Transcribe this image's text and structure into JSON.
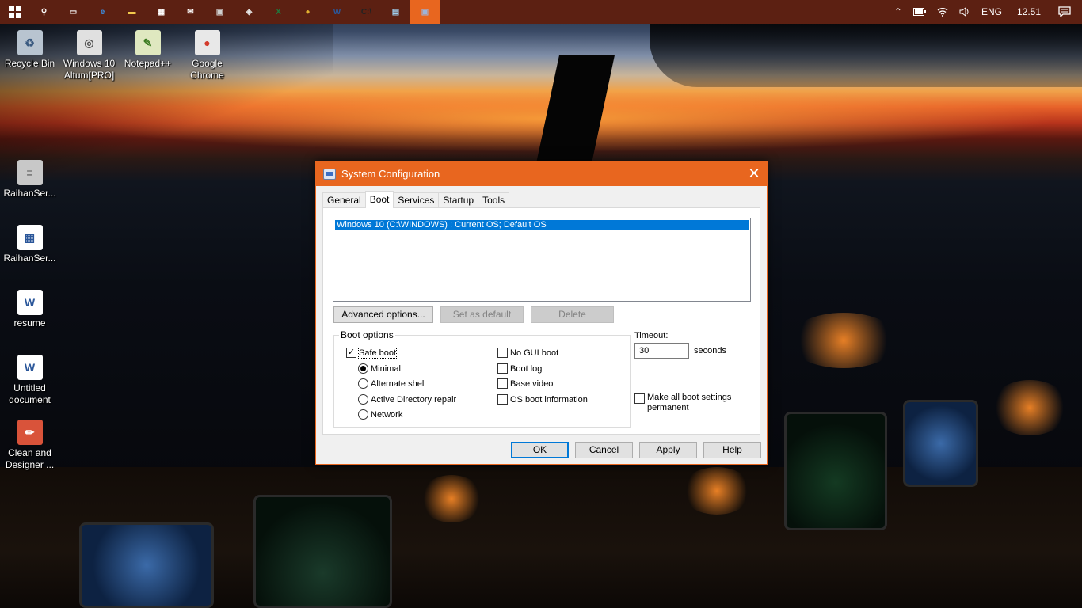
{
  "taskbar": {
    "start_icon": "windows-logo-icon",
    "apps": [
      {
        "name": "search-icon",
        "glyph": "⚲",
        "color": "#ffffff"
      },
      {
        "name": "task-view-icon",
        "glyph": "▭",
        "color": "#ffffff"
      },
      {
        "name": "edge-icon",
        "glyph": "e",
        "color": "#3b8de0"
      },
      {
        "name": "file-explorer-icon",
        "glyph": "▬",
        "color": "#f2c94c"
      },
      {
        "name": "store-icon",
        "glyph": "▦",
        "color": "#ffffff"
      },
      {
        "name": "mail-icon",
        "glyph": "✉",
        "color": "#ffffff"
      },
      {
        "name": "media-icon",
        "glyph": "▣",
        "color": "#cfcfcf"
      },
      {
        "name": "app-icon",
        "glyph": "◈",
        "color": "#e8e8e8"
      },
      {
        "name": "excel-icon",
        "glyph": "X",
        "color": "#1f7a3e"
      },
      {
        "name": "chrome-icon",
        "glyph": "●",
        "color": "#e0b030"
      },
      {
        "name": "word-icon",
        "glyph": "W",
        "color": "#2b579a"
      },
      {
        "name": "cmd-icon",
        "glyph": "C:\\",
        "color": "#222222"
      },
      {
        "name": "notepad-icon",
        "glyph": "▤",
        "color": "#9fd0f0"
      },
      {
        "name": "system-config-icon",
        "glyph": "▣",
        "color": "#9fb4d8"
      }
    ],
    "tray": {
      "chevron": "⌃",
      "lang": "ENG",
      "time": "12.51"
    }
  },
  "desktop": {
    "icons": [
      {
        "label": "Recycle Bin",
        "name": "recycle-bin-icon",
        "glyph": "♻",
        "bg": "#b8c4d0",
        "fg": "#3a5a80"
      },
      {
        "label": "Windows 10 Altum[PRO]",
        "name": "windows-iso-icon",
        "glyph": "◎",
        "bg": "#e0e0e0",
        "fg": "#555555"
      },
      {
        "label": "Notepad++",
        "name": "notepad-plus-icon",
        "glyph": "✎",
        "bg": "#dfe8c0",
        "fg": "#3a7a20"
      },
      {
        "label": "Google Chrome",
        "name": "google-chrome-icon",
        "glyph": "●",
        "bg": "#e8e8e8",
        "fg": "#d33b2c"
      },
      {
        "label": "RaihanSer...",
        "name": "server-icon",
        "glyph": "≡",
        "bg": "#c8c8c8",
        "fg": "#555555"
      },
      {
        "label": "RaihanSer...",
        "name": "calendar-file-icon",
        "glyph": "▦",
        "bg": "#ffffff",
        "fg": "#2b579a"
      },
      {
        "label": "resume",
        "name": "word-document-icon",
        "glyph": "W",
        "bg": "#ffffff",
        "fg": "#2b579a"
      },
      {
        "label": "Untitled document",
        "name": "word-document-icon-2",
        "glyph": "W",
        "bg": "#ffffff",
        "fg": "#2b579a"
      },
      {
        "label": "Clean and Designer ...",
        "name": "pencil-app-icon",
        "glyph": "✏",
        "bg": "#d9533a",
        "fg": "#ffffff"
      }
    ]
  },
  "dialog": {
    "title": "System Configuration",
    "close_glyph": "✕",
    "tabs": [
      "General",
      "Boot",
      "Services",
      "Startup",
      "Tools"
    ],
    "selected_tab": "Boot",
    "os_list": [
      "Windows 10 (C:\\WINDOWS) : Current OS; Default OS"
    ],
    "buttons": {
      "advanced": "Advanced options...",
      "set_default": "Set as default",
      "delete": "Delete"
    },
    "boot_options": {
      "legend": "Boot options",
      "safe_boot": {
        "label": "Safe boot",
        "checked": true
      },
      "radios": [
        {
          "label": "Minimal",
          "selected": true
        },
        {
          "label": "Alternate shell",
          "selected": false
        },
        {
          "label": "Active Directory repair",
          "selected": false
        },
        {
          "label": "Network",
          "selected": false
        }
      ],
      "checks": [
        {
          "label": "No GUI boot",
          "checked": false
        },
        {
          "label": "Boot log",
          "checked": false
        },
        {
          "label": "Base video",
          "checked": false
        },
        {
          "label": "OS boot information",
          "checked": false
        }
      ]
    },
    "timeout": {
      "label": "Timeout:",
      "value": "30",
      "unit": "seconds"
    },
    "make_permanent": {
      "label": "Make all boot settings permanent",
      "checked": false
    },
    "footer": {
      "ok": "OK",
      "cancel": "Cancel",
      "apply": "Apply",
      "help": "Help"
    }
  }
}
